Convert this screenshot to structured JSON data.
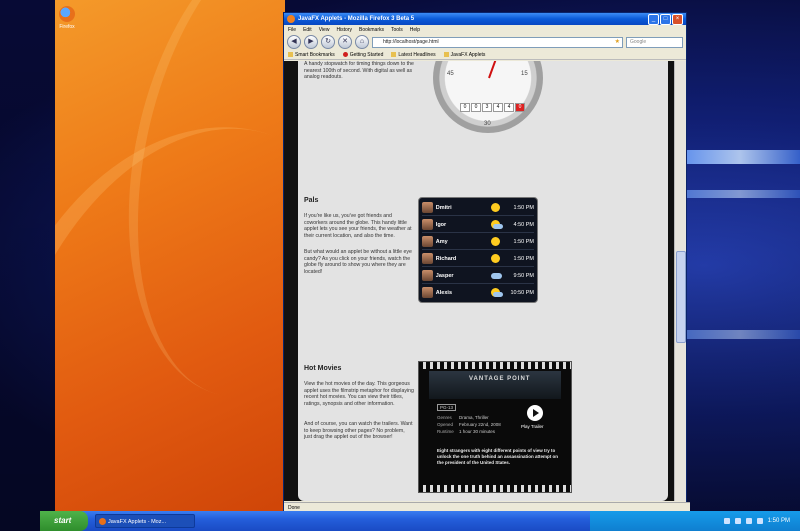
{
  "desktop": {
    "icon_label": "Firefox"
  },
  "browser": {
    "title": "JavaFX Applets - Mozilla Firefox 3 Beta 5",
    "menu": [
      "File",
      "Edit",
      "View",
      "History",
      "Bookmarks",
      "Tools",
      "Help"
    ],
    "url": "http://localhost/page.html",
    "search_placeholder": "Google",
    "bookmarks": [
      "Smart Bookmarks",
      "Getting Started",
      "Latest Headlines",
      "JavaFX Applets"
    ],
    "status": "Done"
  },
  "stopwatch": {
    "description": "A handy stopwatch for timing things down to the nearest 100th of second. With digital as well as analog readouts.",
    "dial_numbers": [
      "45",
      "15",
      "30"
    ],
    "readout": [
      "0",
      "0",
      "3",
      "4",
      "4",
      "0"
    ]
  },
  "pals": {
    "heading": "Pals",
    "description_1": "If you're like us, you've got friends and coworkers around the globe. This handy little applet lets you see your friends, the weather at their current location, and also the time.",
    "description_2": "But what would an applet be without a little eye candy? As you click on your friends, watch the globe fly around to show you where they are located!",
    "rows": [
      {
        "name": "Dmitri",
        "weather": "sunny",
        "time": "1:50 PM"
      },
      {
        "name": "Igor",
        "weather": "partly-cloudy",
        "time": "4:50 PM"
      },
      {
        "name": "Amy",
        "weather": "sunny",
        "time": "1:50 PM"
      },
      {
        "name": "Richard",
        "weather": "sunny",
        "time": "1:50 PM"
      },
      {
        "name": "Jasper",
        "weather": "cloudy",
        "time": "9:50 PM"
      },
      {
        "name": "Alexis",
        "weather": "partly-cloudy",
        "time": "10:50 PM"
      }
    ]
  },
  "movies": {
    "heading": "Hot Movies",
    "description_1": "View the hot movies of the day. This gorgeous applet uses the filmstrip metaphor for displaying recent hot movies. You can view their titles, ratings, synopsis and other information.",
    "description_2": "And of course, you can watch the trailers. Want to keep browsing other pages? No problem, just drag the applet out of the browser!",
    "poster_title": "VANTAGE POINT",
    "rating": "PG-13",
    "genres_label": "Genres",
    "genres": "Drama, Thriller",
    "opened_label": "Opened",
    "opened": "February 22nd, 2008",
    "runtime_label": "Runtime",
    "runtime": "1 hour 30 minutes",
    "play_label": "Play Trailer",
    "synopsis": "Eight strangers with eight different points of view try to unlock the one truth behind an assassination attempt on the president of the United States."
  },
  "taskbar": {
    "start_label": "start",
    "task_label": "JavaFX Applets - Moz...",
    "time": "1:50 PM"
  }
}
